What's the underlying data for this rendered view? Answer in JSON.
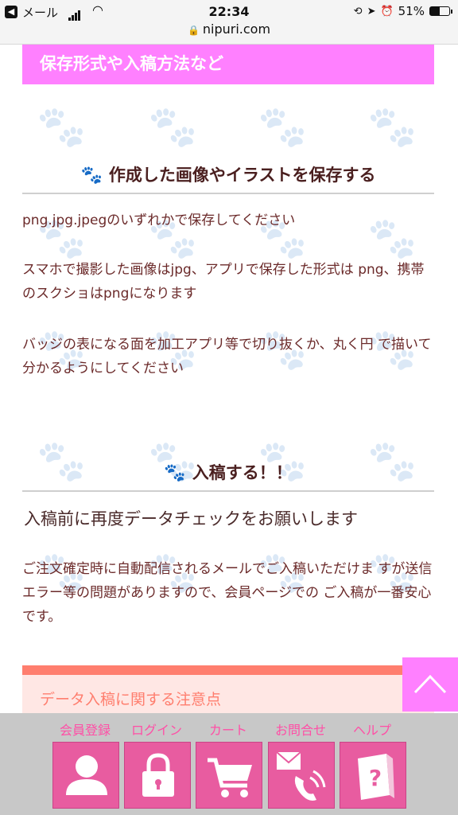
{
  "status_bar": {
    "carrier": "メール",
    "time": "22:34",
    "battery": "51%",
    "battery_level": 0.51,
    "url": "nipuri.com"
  },
  "section_banner": "保存形式や入稿方法など",
  "save_section": {
    "heading": "作成した画像やイラストを保存する",
    "paragraphs": [
      "png.jpg.jpegのいずれかで保存してください",
      "スマホで撮影した画像はjpg、アプリで保存した形式は png、携帯のスクショはpngになります",
      "バッジの表になる面を加工アプリ等で切り抜くか、丸く円 で描いて分かるようにしてください"
    ]
  },
  "submit_section": {
    "heading": "入稿する！！",
    "lead": "入稿前に再度データチェックをお願いします",
    "paragraph": "ご注文確定時に自動配信されるメールでご入稿いただけま すが送信エラー等の問題がありますので、会員ページでの ご入稿が一番安心です。"
  },
  "note_box": {
    "title": "データ入稿に関する注意点"
  },
  "bottom_nav": [
    {
      "label": "会員登録",
      "icon": "user-icon"
    },
    {
      "label": "ログイン",
      "icon": "lock-icon"
    },
    {
      "label": "カート",
      "icon": "cart-icon"
    },
    {
      "label": "お問合せ",
      "icon": "mail-phone-icon"
    },
    {
      "label": "ヘルプ",
      "icon": "help-book-icon"
    }
  ],
  "colors": {
    "accent_pink": "#ff80ff",
    "nav_pink": "#e85ca0",
    "note_coral": "#ff7e6e",
    "text_brown": "#6b2a2a"
  }
}
